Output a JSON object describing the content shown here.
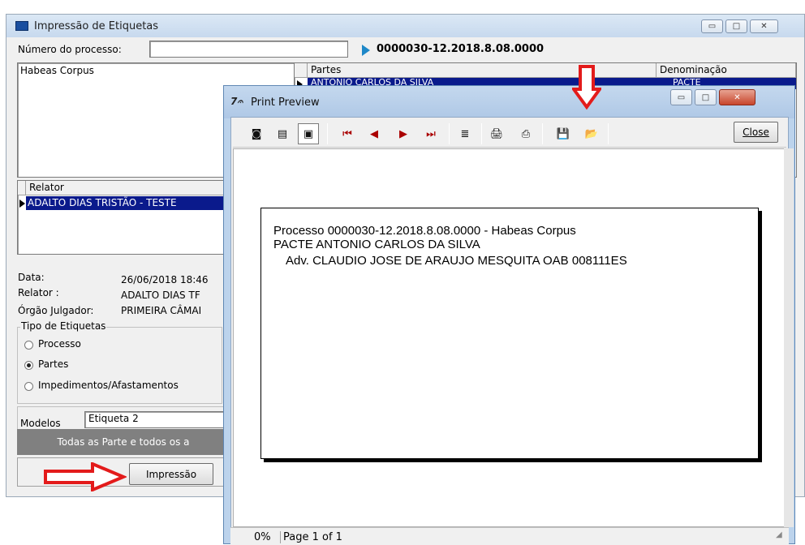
{
  "main_window": {
    "title": "Impressão de Etiquetas",
    "process_label": "Número do processo:",
    "process_value": "",
    "process_number": "0000030-12.2018.8.08.0000",
    "class_list": [
      "Habeas Corpus"
    ],
    "partes_grid": {
      "headers": [
        "Partes",
        "Denominação"
      ],
      "rows": [
        {
          "parte": "ANTONIO CARLOS DA SILVA",
          "denominacao": "PACTE"
        }
      ]
    },
    "relator_grid": {
      "header": "Relator",
      "rows": [
        "ADALTO DIAS TRISTÃO - TESTE"
      ]
    },
    "info": {
      "data_label": "Data:",
      "data_value": "26/06/2018 18:46",
      "relator_label": "Relator :",
      "relator_value": "ADALTO DIAS TF",
      "orgao_label": "Órgão Julgador:",
      "orgao_value": "PRIMEIRA CÂMAI"
    },
    "tipo_group": {
      "title": "Tipo de Etiquetas",
      "options": [
        "Processo",
        "Partes",
        "Impedimentos/Afastamentos"
      ],
      "selected": "Partes"
    },
    "modelos_label": "Modelos",
    "modelos_value": "Etiqueta 2",
    "info_bar": "Todas as Parte e todos os a",
    "print_button": "Impressão"
  },
  "preview": {
    "title": "Print Preview",
    "close_button": "Close",
    "page_lines": [
      "Processo 0000030-12.2018.8.08.0000 - Habeas Corpus",
      "PACTE ANTONIO CARLOS DA SILVA",
      "Adv. CLAUDIO JOSE DE ARAUJO MESQUITA OAB 008111ES"
    ],
    "status_zoom": "0%",
    "status_page": "Page 1 of 1"
  },
  "colors": {
    "selection": "#0a1a8c",
    "annotation_arrow": "#e31b1b",
    "play_marker": "#1e88c8"
  }
}
